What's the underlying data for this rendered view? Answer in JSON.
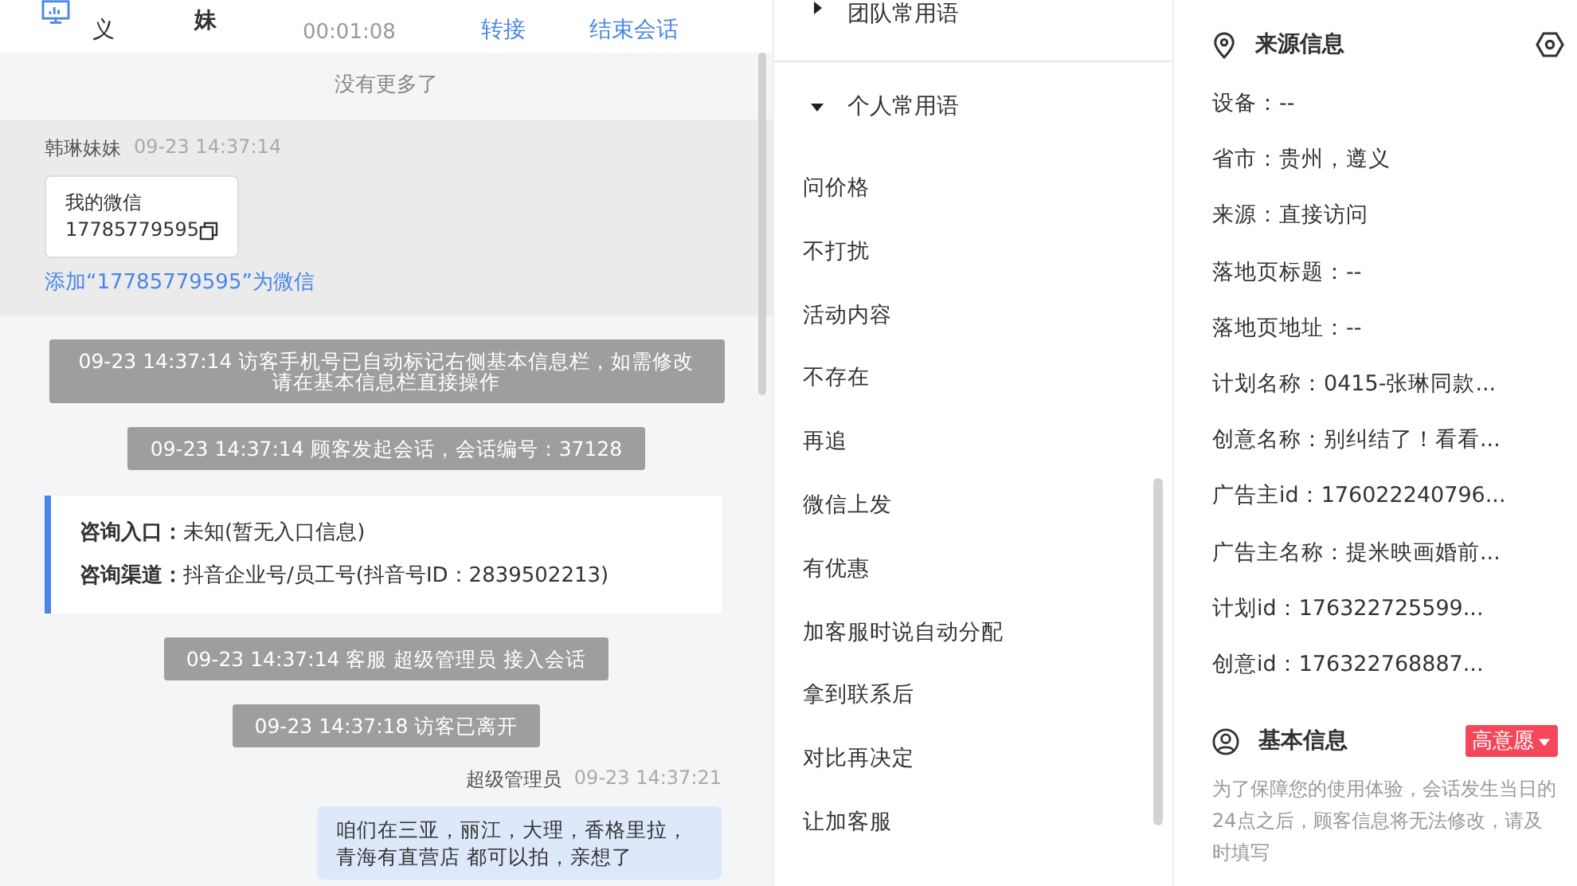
{
  "header": {
    "location": "义",
    "visitor": "妹",
    "duration": "00:01:08",
    "actions": [
      {
        "label": "转接"
      },
      {
        "label": "结束会话"
      }
    ]
  },
  "chat": {
    "no_more": "没有更多了",
    "messages": [
      {
        "kind": "visitor",
        "sender": "韩琳妹妹",
        "time": "09-23 14:37:14",
        "card_title": "我的微信",
        "card_number": "17785779595",
        "link": "添加“17785779595”为微信"
      },
      {
        "kind": "system",
        "text": "09-23 14:37:14 访客手机号已自动标记右侧基本信息栏，如需修改请在基本信息栏直接操作"
      },
      {
        "kind": "system",
        "text": "09-23 14:37:14 顾客发起会话，会话编号：37128"
      },
      {
        "kind": "info",
        "rows": [
          {
            "label": "咨询入口：",
            "value": "未知(暂无入口信息)"
          },
          {
            "label": "咨询渠道：",
            "value": "抖音企业号/员工号(抖音号ID：2839502213)"
          }
        ]
      },
      {
        "kind": "system",
        "text": "09-23 14:37:14 客服 超级管理员 接入会话"
      },
      {
        "kind": "system",
        "text": "09-23 14:37:18 访客已离开"
      },
      {
        "kind": "agent",
        "sender": "超级管理员",
        "time": "09-23 14:37:21",
        "text": "咱们在三亚，丽江，大理，香格里拉，青海有直营店 都可以拍，亲想了"
      }
    ]
  },
  "phrases": {
    "groups": [
      {
        "label": "团队常用语",
        "expanded": false
      },
      {
        "label": "个人常用语",
        "expanded": true
      }
    ],
    "items": [
      "问价格",
      "不打扰",
      "活动内容",
      "不存在",
      "再追",
      "微信上发",
      "有优惠",
      "加客服时说自动分配",
      "拿到联系后",
      "对比再决定",
      "让加客服"
    ]
  },
  "source": {
    "title": "来源信息",
    "fields": [
      "设备：--",
      "省市：贵州，遵义",
      "来源：直接访问",
      "落地页标题：--",
      "落地页地址：--",
      "计划名称：0415-张琳同款...",
      "创意名称：别纠结了！看看...",
      "广告主id：176022240796...",
      "广告主名称：提米映画婚前...",
      "计划id：176322725599...",
      "创意id：176322768887..."
    ]
  },
  "basic": {
    "title": "基本信息",
    "tag": {
      "label": "高意愿",
      "color": "#f5475a"
    },
    "note": "为了保障您的使用体验，会话发生当日的24点之后，顾客信息将无法修改，请及时填写"
  }
}
